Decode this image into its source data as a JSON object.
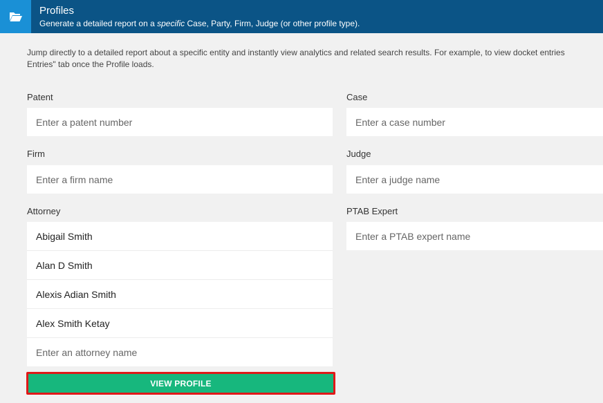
{
  "header": {
    "title": "Profiles",
    "subtitle_pre": "Generate a detailed report on a ",
    "subtitle_em": "specific",
    "subtitle_post": " Case, Party, Firm, Judge (or other profile type).",
    "icon": "folder-open-icon"
  },
  "intro": {
    "line1": "Jump directly to a detailed report about a specific entity and instantly view analytics and related search results. For example, to view docket entries",
    "line2": "Entries\" tab once the Profile loads."
  },
  "fields": {
    "patent": {
      "label": "Patent",
      "placeholder": "Enter a patent number"
    },
    "case": {
      "label": "Case",
      "placeholder": "Enter a case number"
    },
    "firm": {
      "label": "Firm",
      "placeholder": "Enter a firm name"
    },
    "judge": {
      "label": "Judge",
      "placeholder": "Enter a judge name"
    },
    "attorney": {
      "label": "Attorney",
      "placeholder": "Enter an attorney name"
    },
    "ptab": {
      "label": "PTAB Expert",
      "placeholder": "Enter a PTAB expert name"
    }
  },
  "attorney_suggestions": [
    "Abigail Smith",
    "Alan D Smith",
    "Alexis Adian Smith",
    "Alex Smith Ketay"
  ],
  "button": {
    "label": "VIEW PROFILE"
  },
  "colors": {
    "header_bg": "#0b5486",
    "icon_box": "#1a90d6",
    "button_bg": "#17b77d",
    "highlight": "#e01818"
  }
}
